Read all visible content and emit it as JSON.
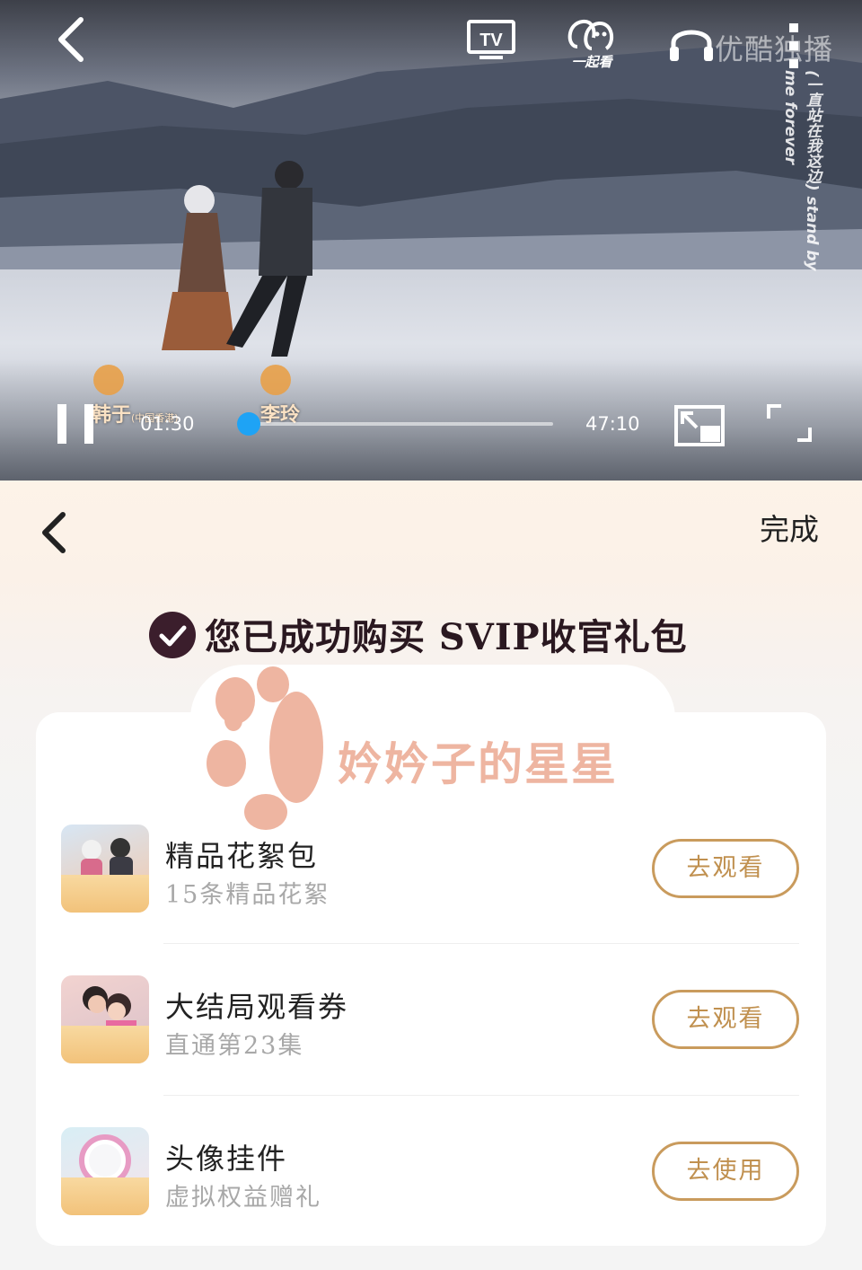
{
  "player": {
    "together_label": "一起看",
    "watermark": "优酷独播",
    "vertical_subtitle": "(一直站在我这边) stand by me forever",
    "credits": [
      {
        "name": "韩于",
        "note": "(中国香港)"
      },
      {
        "name": "李玲",
        "note": ""
      }
    ],
    "current_time": "01:30",
    "total_time": "47:10",
    "progress": 0.032,
    "accent_color": "#1ea3f5",
    "icons": [
      "back-arrow-icon",
      "tv-cast-icon",
      "watch-together-icon",
      "headphone-icon",
      "more-icon",
      "pause-icon",
      "pip-icon",
      "fullscreen-icon"
    ]
  },
  "panel": {
    "done_label": "完成",
    "success_message": "您已成功购买 SVIP收官礼包",
    "stamp_text": "妗妗子的星星",
    "items": [
      {
        "title": "精品花絮包",
        "subtitle": "15条精品花絮",
        "action": "去观看"
      },
      {
        "title": "大结局观看券",
        "subtitle": "直通第23集",
        "action": "去观看"
      },
      {
        "title": "头像挂件",
        "subtitle": "虚拟权益赠礼",
        "action": "去使用"
      }
    ],
    "button_color": "#c99b5d"
  }
}
